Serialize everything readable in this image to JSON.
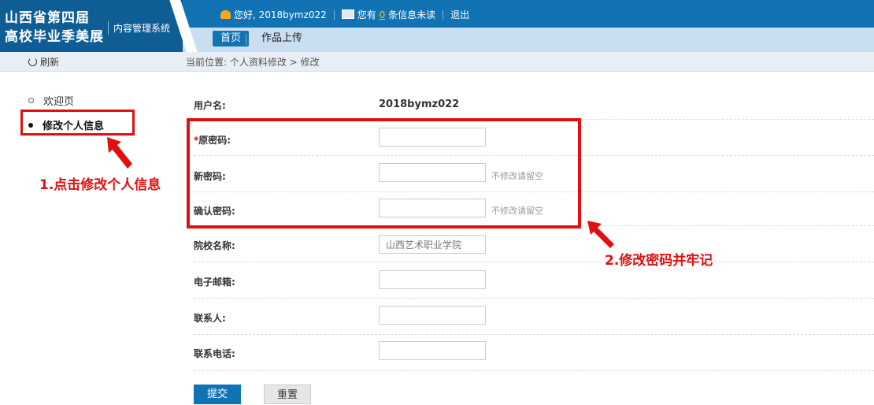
{
  "header": {
    "logo_line1": "山西省第四届",
    "logo_line2": "高校毕业季美展",
    "system_name": "内容管理系统",
    "greeting": "您好, 2018bymz022",
    "msg_prefix": "您有",
    "msg_count": "0",
    "msg_suffix": "条信息未读",
    "logout": "退出",
    "nav_home": "首页",
    "nav_upload": "作品上传"
  },
  "toolbar": {
    "refresh": "刷新",
    "breadcrumb": "当前位置: 个人资料修改 > 修改"
  },
  "sidebar": {
    "items": [
      {
        "label": "欢迎页"
      },
      {
        "label": "修改个人信息"
      }
    ]
  },
  "form": {
    "username_label": "用户名:",
    "username_value": "2018bymz022",
    "old_pwd_star": "*",
    "old_pwd_label": "原密码:",
    "new_pwd_label": "新密码:",
    "new_pwd_hint": "不修改请留空",
    "confirm_pwd_label": "确认密码:",
    "confirm_pwd_hint": "不修改请留空",
    "school_label": "院校名称:",
    "school_value": "山西艺术职业学院",
    "email_label": "电子邮箱:",
    "email_value": "",
    "contact_label": "联系人:",
    "contact_value": "",
    "phone_label": "联系电话:",
    "phone_value": "",
    "submit": "提交",
    "reset": "重置"
  },
  "annotations": {
    "note1": "1.点击修改个人信息",
    "note2": "2.修改密码并牢记",
    "color": "#e01010"
  },
  "colors": {
    "header_dark": "#0e5e95",
    "header": "#1273b4",
    "nav_bg": "#c9def0"
  }
}
